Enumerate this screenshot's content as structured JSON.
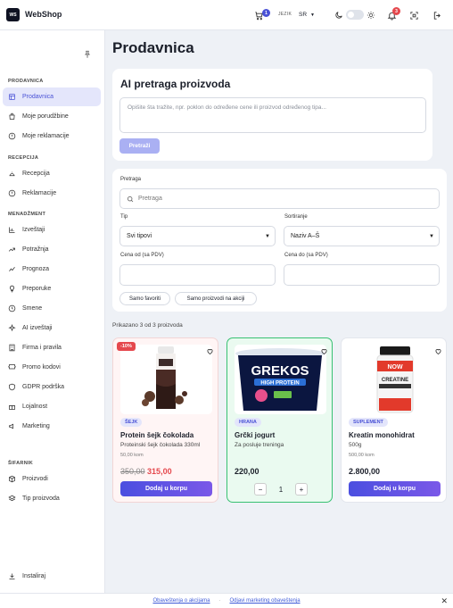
{
  "header": {
    "brand": "WebShop",
    "logo_text": "WS",
    "cart_count": "1",
    "lang_label": "JEZIK",
    "lang_value": "SR",
    "notif_count": "3"
  },
  "sidebar": {
    "sections": [
      {
        "title": "PRODAVNICA",
        "items": [
          {
            "label": "Prodavnica",
            "icon": "store-icon"
          },
          {
            "label": "Moje porudžbine",
            "icon": "bag-icon"
          },
          {
            "label": "Moje reklamacije",
            "icon": "alert-icon"
          }
        ]
      },
      {
        "title": "RECEPCIJA",
        "items": [
          {
            "label": "Recepcija",
            "icon": "concierge-icon"
          },
          {
            "label": "Reklamacije",
            "icon": "alert-icon"
          }
        ]
      },
      {
        "title": "MENADŽMENT",
        "items": [
          {
            "label": "Izveštaji",
            "icon": "chart-icon"
          },
          {
            "label": "Potražnja",
            "icon": "trend-icon"
          },
          {
            "label": "Prognoza",
            "icon": "forecast-icon"
          },
          {
            "label": "Preporuke",
            "icon": "bulb-icon"
          },
          {
            "label": "Smene",
            "icon": "clock-icon"
          },
          {
            "label": "AI izveštaji",
            "icon": "sparkle-icon"
          },
          {
            "label": "Firma i pravila",
            "icon": "building-icon"
          },
          {
            "label": "Promo kodovi",
            "icon": "ticket-icon"
          },
          {
            "label": "GDPR podrška",
            "icon": "shield-icon"
          },
          {
            "label": "Lojalnost",
            "icon": "gift-icon"
          },
          {
            "label": "Marketing",
            "icon": "megaphone-icon"
          }
        ]
      },
      {
        "title": "ŠIFARNIK",
        "items": [
          {
            "label": "Proizvodi",
            "icon": "box-icon"
          },
          {
            "label": "Tip proizvoda",
            "icon": "layers-icon"
          }
        ]
      }
    ],
    "install": "Instaliraj"
  },
  "page": {
    "title": "Prodavnica"
  },
  "ai": {
    "title": "AI pretraga proizvoda",
    "placeholder": "Opišite šta tražite, npr. poklon do određene cene ili proizvod određenog tipa...",
    "button": "Pretraži"
  },
  "filters": {
    "search_label": "Pretraga",
    "search_placeholder": "Pretraga",
    "type_label": "Tip",
    "type_value": "Svi tipovi",
    "sort_label": "Sortiranje",
    "sort_value": "Naziv A–Š",
    "price_from_label": "Cena od (sa PDV)",
    "price_to_label": "Cena do (sa PDV)",
    "chip_favorites": "Samo favoriti",
    "chip_sale": "Samo proizvodi na akciji"
  },
  "results": {
    "count_text": "Prikazano 3 od 3 proizvoda"
  },
  "products": [
    {
      "discount": "-10%",
      "category": "ŠEJK",
      "name": "Protein šejk čokolada",
      "desc": "Proteinski šejk čokolada 330ml",
      "stock": "50,00 kom",
      "old_price": "350,00",
      "price": "315,00",
      "button": "Dodaj u korpu",
      "cat_color": "#e3e5fb",
      "cat_text": "#4a52d6"
    },
    {
      "category": "HRANA",
      "name": "Grčki jogurt",
      "desc": "Za posluje treninga",
      "stock": "",
      "price": "220,00",
      "qty": "1",
      "cat_color": "#e3e5fb",
      "cat_text": "#4a52d6"
    },
    {
      "category": "SUPLEMENT",
      "name": "Kreatin monohidrat",
      "desc": "500g",
      "stock": "500,00 kom",
      "price": "2.800,00",
      "button": "Dodaj u korpu",
      "cat_color": "#e3e5fb",
      "cat_text": "#4a52d6"
    }
  ],
  "footer": {
    "link1": "Obaveštenja o akcijama",
    "sep": "·",
    "link2": "Odjavi marketing obaveštenja"
  }
}
